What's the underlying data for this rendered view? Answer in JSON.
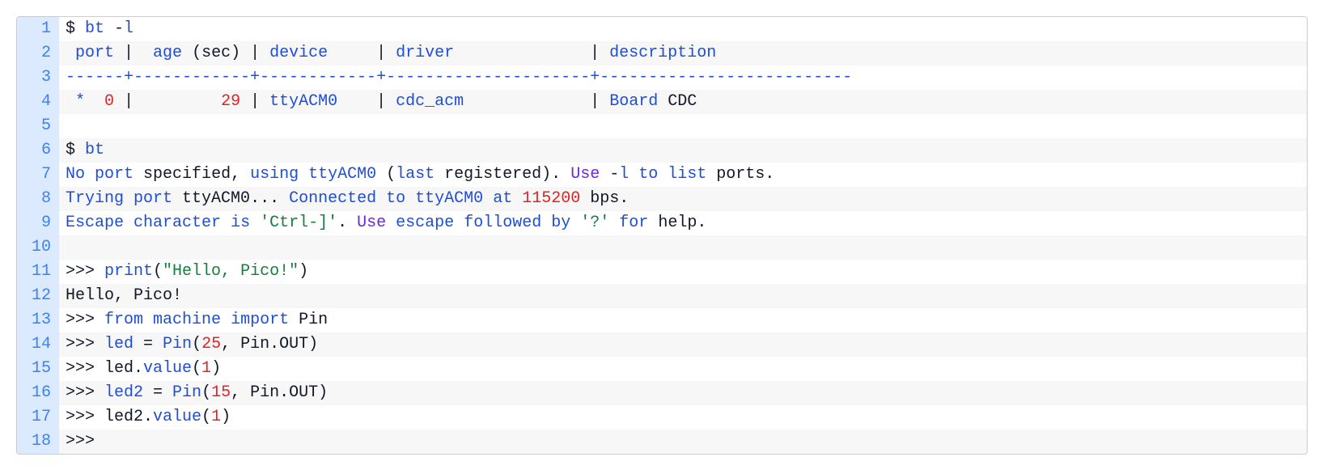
{
  "palette": {
    "blue": "#1d4ed8",
    "red": "#dc2626",
    "black": "#111827",
    "purple": "#6d28d9",
    "green": "#15803d"
  },
  "lines": [
    {
      "n": 1,
      "tokens": [
        {
          "t": "$ ",
          "c": "black"
        },
        {
          "t": "bt",
          "c": "blue"
        },
        {
          "t": " -",
          "c": "black"
        },
        {
          "t": "l",
          "c": "blue"
        }
      ]
    },
    {
      "n": 2,
      "tokens": [
        {
          "t": " ",
          "c": "black"
        },
        {
          "t": "port",
          "c": "blue"
        },
        {
          "t": " |  ",
          "c": "black"
        },
        {
          "t": "age",
          "c": "blue"
        },
        {
          "t": " (sec) | ",
          "c": "black"
        },
        {
          "t": "device",
          "c": "blue"
        },
        {
          "t": "     | ",
          "c": "black"
        },
        {
          "t": "driver",
          "c": "blue"
        },
        {
          "t": "              | ",
          "c": "black"
        },
        {
          "t": "description",
          "c": "blue"
        }
      ]
    },
    {
      "n": 3,
      "tokens": [
        {
          "t": "------+------------+------------+---------------------+--------------------------",
          "c": "blue"
        }
      ]
    },
    {
      "n": 4,
      "tokens": [
        {
          "t": " ",
          "c": "black"
        },
        {
          "t": "*",
          "c": "blue"
        },
        {
          "t": "  ",
          "c": "black"
        },
        {
          "t": "0",
          "c": "red"
        },
        {
          "t": " |         ",
          "c": "black"
        },
        {
          "t": "29",
          "c": "red"
        },
        {
          "t": " | ",
          "c": "black"
        },
        {
          "t": "ttyACM0",
          "c": "blue"
        },
        {
          "t": "    | ",
          "c": "black"
        },
        {
          "t": "cdc_acm",
          "c": "blue"
        },
        {
          "t": "             | ",
          "c": "black"
        },
        {
          "t": "Board",
          "c": "blue"
        },
        {
          "t": " CDC",
          "c": "black"
        }
      ]
    },
    {
      "n": 5,
      "tokens": [
        {
          "t": "",
          "c": "black"
        }
      ]
    },
    {
      "n": 6,
      "tokens": [
        {
          "t": "$ ",
          "c": "black"
        },
        {
          "t": "bt",
          "c": "blue"
        }
      ]
    },
    {
      "n": 7,
      "tokens": [
        {
          "t": "No",
          "c": "blue"
        },
        {
          "t": " ",
          "c": "black"
        },
        {
          "t": "port",
          "c": "blue"
        },
        {
          "t": " specified, ",
          "c": "black"
        },
        {
          "t": "using",
          "c": "blue"
        },
        {
          "t": " ",
          "c": "black"
        },
        {
          "t": "ttyACM0",
          "c": "blue"
        },
        {
          "t": " (",
          "c": "black"
        },
        {
          "t": "last",
          "c": "blue"
        },
        {
          "t": " registered). ",
          "c": "black"
        },
        {
          "t": "Use",
          "c": "purple"
        },
        {
          "t": " -",
          "c": "black"
        },
        {
          "t": "l",
          "c": "blue"
        },
        {
          "t": " ",
          "c": "black"
        },
        {
          "t": "to",
          "c": "blue"
        },
        {
          "t": " ",
          "c": "black"
        },
        {
          "t": "list",
          "c": "blue"
        },
        {
          "t": " ports.",
          "c": "black"
        }
      ]
    },
    {
      "n": 8,
      "tokens": [
        {
          "t": "Trying",
          "c": "blue"
        },
        {
          "t": " ",
          "c": "black"
        },
        {
          "t": "port",
          "c": "blue"
        },
        {
          "t": " ttyACM0... ",
          "c": "black"
        },
        {
          "t": "Connected",
          "c": "blue"
        },
        {
          "t": " ",
          "c": "black"
        },
        {
          "t": "to",
          "c": "blue"
        },
        {
          "t": " ",
          "c": "black"
        },
        {
          "t": "ttyACM0",
          "c": "blue"
        },
        {
          "t": " ",
          "c": "black"
        },
        {
          "t": "at",
          "c": "blue"
        },
        {
          "t": " ",
          "c": "black"
        },
        {
          "t": "115200",
          "c": "red"
        },
        {
          "t": " bps.",
          "c": "black"
        }
      ]
    },
    {
      "n": 9,
      "tokens": [
        {
          "t": "Escape",
          "c": "blue"
        },
        {
          "t": " ",
          "c": "black"
        },
        {
          "t": "character",
          "c": "blue"
        },
        {
          "t": " ",
          "c": "black"
        },
        {
          "t": "is",
          "c": "blue"
        },
        {
          "t": " ",
          "c": "black"
        },
        {
          "t": "'Ctrl-]'",
          "c": "green"
        },
        {
          "t": ". ",
          "c": "black"
        },
        {
          "t": "Use",
          "c": "purple"
        },
        {
          "t": " ",
          "c": "black"
        },
        {
          "t": "escape",
          "c": "blue"
        },
        {
          "t": " ",
          "c": "black"
        },
        {
          "t": "followed",
          "c": "blue"
        },
        {
          "t": " ",
          "c": "black"
        },
        {
          "t": "by",
          "c": "blue"
        },
        {
          "t": " ",
          "c": "black"
        },
        {
          "t": "'?'",
          "c": "green"
        },
        {
          "t": " ",
          "c": "black"
        },
        {
          "t": "for",
          "c": "blue"
        },
        {
          "t": " help.",
          "c": "black"
        }
      ]
    },
    {
      "n": 10,
      "tokens": [
        {
          "t": "",
          "c": "black"
        }
      ]
    },
    {
      "n": 11,
      "tokens": [
        {
          "t": ">>> ",
          "c": "black"
        },
        {
          "t": "print",
          "c": "blue"
        },
        {
          "t": "(",
          "c": "black"
        },
        {
          "t": "\"Hello, Pico!\"",
          "c": "green"
        },
        {
          "t": ")",
          "c": "black"
        }
      ]
    },
    {
      "n": 12,
      "tokens": [
        {
          "t": "Hello, Pico!",
          "c": "black"
        }
      ]
    },
    {
      "n": 13,
      "tokens": [
        {
          "t": ">>> ",
          "c": "black"
        },
        {
          "t": "from",
          "c": "blue"
        },
        {
          "t": " ",
          "c": "black"
        },
        {
          "t": "machine",
          "c": "blue"
        },
        {
          "t": " ",
          "c": "black"
        },
        {
          "t": "import",
          "c": "blue"
        },
        {
          "t": " Pin",
          "c": "black"
        }
      ]
    },
    {
      "n": 14,
      "tokens": [
        {
          "t": ">>> ",
          "c": "black"
        },
        {
          "t": "led",
          "c": "blue"
        },
        {
          "t": " = ",
          "c": "black"
        },
        {
          "t": "Pin",
          "c": "blue"
        },
        {
          "t": "(",
          "c": "black"
        },
        {
          "t": "25",
          "c": "red"
        },
        {
          "t": ", Pin.OUT)",
          "c": "black"
        }
      ]
    },
    {
      "n": 15,
      "tokens": [
        {
          "t": ">>> led.",
          "c": "black"
        },
        {
          "t": "value",
          "c": "blue"
        },
        {
          "t": "(",
          "c": "black"
        },
        {
          "t": "1",
          "c": "red"
        },
        {
          "t": ")",
          "c": "black"
        }
      ]
    },
    {
      "n": 16,
      "tokens": [
        {
          "t": ">>> ",
          "c": "black"
        },
        {
          "t": "led2",
          "c": "blue"
        },
        {
          "t": " = ",
          "c": "black"
        },
        {
          "t": "Pin",
          "c": "blue"
        },
        {
          "t": "(",
          "c": "black"
        },
        {
          "t": "15",
          "c": "red"
        },
        {
          "t": ", Pin.OUT)",
          "c": "black"
        }
      ]
    },
    {
      "n": 17,
      "tokens": [
        {
          "t": ">>> led2.",
          "c": "black"
        },
        {
          "t": "value",
          "c": "blue"
        },
        {
          "t": "(",
          "c": "black"
        },
        {
          "t": "1",
          "c": "red"
        },
        {
          "t": ")",
          "c": "black"
        }
      ]
    },
    {
      "n": 18,
      "tokens": [
        {
          "t": ">>>",
          "c": "black"
        }
      ]
    }
  ]
}
